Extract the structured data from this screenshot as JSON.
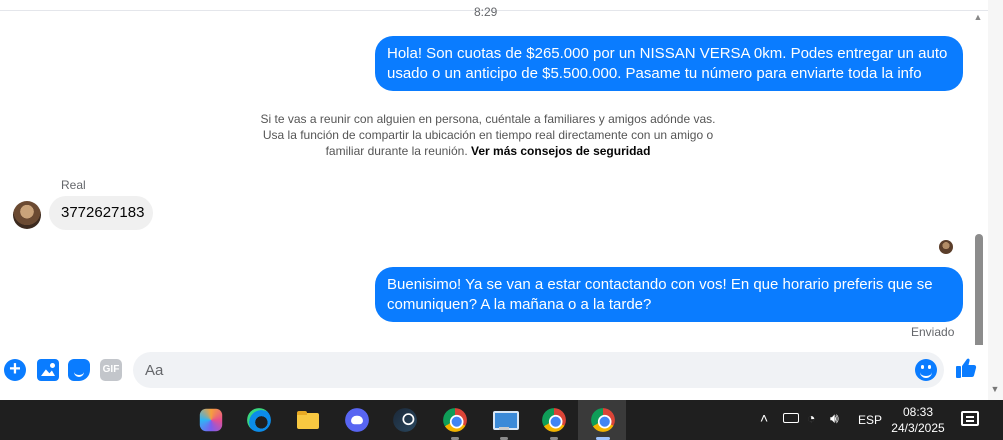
{
  "chat": {
    "timestamp": "8:29",
    "messages": [
      {
        "direction": "out",
        "text": "Hola! Son cuotas de $265.000 por un NISSAN VERSA 0km. Podes entregar un auto usado o un anticipo de $5.500.000. Pasame tu número para enviarte toda la info"
      },
      {
        "direction": "in",
        "sender": "Real",
        "text": "3772627183"
      },
      {
        "direction": "out",
        "text": "Buenisimo! Ya se van a estar contactando con vos! En que horario preferis que se comuniquen? A la mañana o a la tarde?"
      }
    ],
    "safety_notice": {
      "text": "Si te vas a reunir con alguien en persona, cuéntale a familiares y amigos adónde vas. Usa la función de compartir la ubicación en tiempo real directamente con un amigo o familiar durante la reunión.",
      "link": "Ver más consejos de seguridad"
    },
    "status": "Enviado"
  },
  "composer": {
    "placeholder": "Aa",
    "gif_label": "GIF",
    "accent_color": "#0a7cff"
  },
  "taskbar": {
    "apps": [
      "copilot-icon",
      "edge-icon",
      "file-explorer-icon",
      "discord-icon",
      "steam-icon",
      "chrome-icon",
      "remote-desktop-icon",
      "chrome-icon",
      "chrome-icon"
    ],
    "language": "ESP",
    "time": "08:33",
    "date": "24/3/2025"
  }
}
